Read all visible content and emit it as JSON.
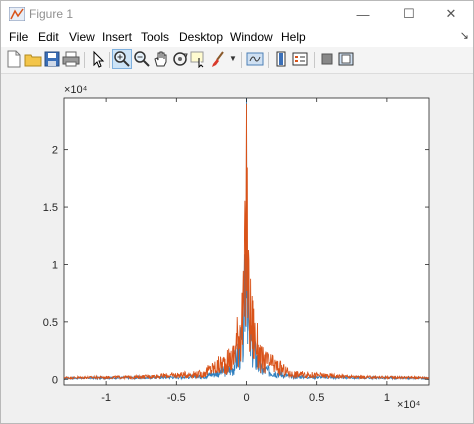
{
  "window": {
    "title": "Figure 1",
    "minimize": "—",
    "maximize": "☐",
    "close": "✕"
  },
  "menu": {
    "items": [
      "File",
      "Edit",
      "View",
      "Insert",
      "Tools",
      "Desktop",
      "Window",
      "Help"
    ],
    "pin": "↘"
  },
  "toolbar": {
    "icons": [
      "new-figure-icon",
      "open-file-icon",
      "save-icon",
      "print-icon",
      "edit-plot-arrow-icon",
      "zoom-in-icon",
      "zoom-out-icon",
      "pan-hand-icon",
      "rotate-3d-icon",
      "data-cursor-icon",
      "brush-icon",
      "link-plot-icon",
      "insert-colorbar-icon",
      "insert-legend-icon",
      "hide-plot-tools-icon",
      "show-plot-tools-icon"
    ],
    "active": "zoom-in-icon"
  },
  "colors": {
    "series1": "#2f7fbf",
    "series2": "#d95319",
    "axes": "#262626"
  },
  "chart_data": {
    "type": "line",
    "title": "",
    "xlabel": "",
    "ylabel": "",
    "x_multiplier": "×10⁴",
    "y_multiplier": "×10⁴",
    "xlim": [
      -1.3,
      1.3
    ],
    "ylim": [
      -0.05,
      2.45
    ],
    "x_unit_scale": 10000,
    "y_unit_scale": 10000,
    "x_ticks": [
      -1,
      -0.5,
      0,
      0.5,
      1
    ],
    "x_tick_labels": [
      "-1",
      "-0.5",
      "0",
      "0.5",
      "1"
    ],
    "y_ticks": [
      0,
      0.5,
      1,
      1.5,
      2
    ],
    "y_tick_labels": [
      "0",
      "0.5",
      "1",
      "1.5",
      "2"
    ],
    "grid": false,
    "series": [
      {
        "peak": 2.45,
        "description_points": [
          [
            -1.3,
            0.02
          ],
          [
            -0.8,
            0.03
          ],
          [
            -0.3,
            0.05
          ],
          [
            -0.1,
            0.15
          ],
          [
            -0.02,
            0.6
          ],
          [
            0,
            2.45
          ],
          [
            0.02,
            0.6
          ],
          [
            0.1,
            0.15
          ],
          [
            0.3,
            0.05
          ],
          [
            0.8,
            0.03
          ],
          [
            1.3,
            0.02
          ]
        ]
      },
      {
        "peak": 2.4,
        "description_points": [
          [
            -1.3,
            0.03
          ],
          [
            -0.8,
            0.04
          ],
          [
            -0.3,
            0.1
          ],
          [
            -0.1,
            0.3
          ],
          [
            -0.02,
            1.0
          ],
          [
            0,
            2.4
          ],
          [
            0.02,
            1.0
          ],
          [
            0.1,
            0.3
          ],
          [
            0.3,
            0.1
          ],
          [
            0.8,
            0.04
          ],
          [
            1.3,
            0.03
          ]
        ]
      }
    ]
  }
}
